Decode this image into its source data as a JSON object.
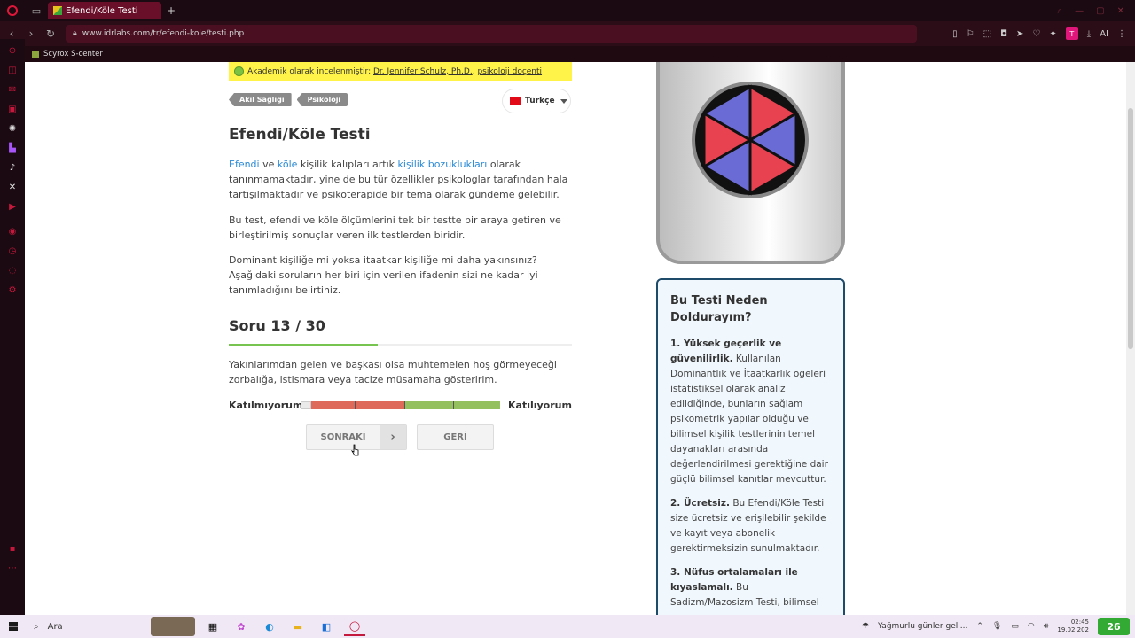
{
  "browser": {
    "tab_title": "Efendi/Köle Testi",
    "new_tab": "+",
    "url": "www.idrlabs.com/tr/efendi-kole/testi.php",
    "bookmark": "Scyrox S-center",
    "profile_initial": "T",
    "ai_label": "AI"
  },
  "page": {
    "review_prefix": "Akademik olarak incelenmiştir:",
    "reviewer": "Dr. Jennifer Schulz, Ph.D.",
    "reviewer_title": "psikoloji doçenti",
    "tags": [
      "Akıl Sağlığı",
      "Psikoloji"
    ],
    "language": "Türkçe",
    "title": "Efendi/Köle Testi",
    "intro": {
      "link1": "Efendi",
      "word_and": "ve",
      "link2": "köle",
      "text1": "kişilik kalıpları artık",
      "link3": "kişilik bozuklukları",
      "text2": "olarak tanınmamaktadır, yine de bu tür özellikler psikologlar tarafından hala tartışılmaktadır ve psikoterapide bir tema olarak gündeme gelebilir."
    },
    "para2": "Bu test, efendi ve köle ölçümlerini tek bir testte bir araya getiren ve birleştirilmiş sonuçlar veren ilk testlerden biridir.",
    "para3": "Dominant kişiliğe mi yoksa itaatkar kişiliğe mi daha yakınsınız? Aşağıdaki soruların her biri için verilen ifadenin sizi ne kadar iyi tanımladığını belirtiniz.",
    "question_heading": "Soru 13 / 30",
    "progress_fraction": 0.433,
    "question_text": "Yakınlarımdan gelen ve başkası olsa muhtemelen hoş görmeyeceği zorbalığa, istismara veya tacize müsamaha gösteririm.",
    "scale_left": "Katılmıyorum",
    "scale_right": "Katılıyorum",
    "next_label": "SONRAKİ",
    "back_label": "GERİ"
  },
  "why": {
    "title": "Bu Testi Neden Doldurayım?",
    "items": [
      {
        "head": "1. Yüksek geçerlik ve güvenilirlik.",
        "body": "Kullanılan Dominantlık ve İtaatkarlık ögeleri istatistiksel olarak analiz edildiğinde, bunların sağlam psikometrik yapılar olduğu ve bilimsel kişilik testlerinin temel dayanakları arasında değerlendirilmesi gerektiğine dair güçlü bilimsel kanıtlar mevcuttur."
      },
      {
        "head": "2. Ücretsiz.",
        "body": "Bu Efendi/Köle Testi size ücretsiz ve erişilebilir şekilde ve kayıt veya abonelik gerektirmeksizin sunulmaktadır."
      },
      {
        "head": "3. Nüfus ortalamaları ile kıyaslamalı.",
        "body": "Bu Sadizm/Mazosizm Testi, bilimsel"
      }
    ]
  },
  "taskbar": {
    "search_placeholder": "Ara",
    "weather": "Yağmurlu günler geli...",
    "time": "02:45",
    "date": "19.02.202",
    "notif": "26"
  }
}
